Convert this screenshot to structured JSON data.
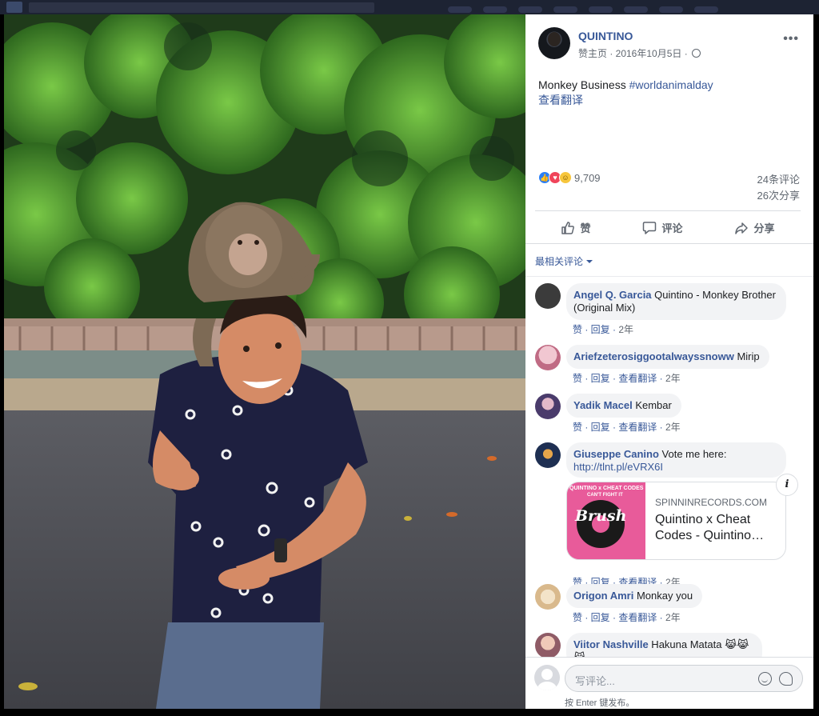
{
  "post": {
    "page_name": "QUINTINO",
    "meta": "赞主页 · 2016年10月5日 ·",
    "text": "Monkey Business ",
    "hashtag": "#worldanimalday",
    "translate": "查看翻译",
    "reaction_count": "9,709",
    "comments_count": "24条评论",
    "shares_count": "26次分享"
  },
  "actions": {
    "like": "赞",
    "comment": "评论",
    "share": "分享"
  },
  "sort_label": "最相关评论",
  "comments": [
    {
      "author": "Angel Q. Garcia",
      "text": " Quintino - Monkey Brother (Original Mix)",
      "actions": "赞 · 回复 · ",
      "age": "2年",
      "avatar_color": "#3b3b3b"
    },
    {
      "author": "Ariefzeterosiggootalwayssnoww",
      "text": " Mirip",
      "actions": "赞 · 回复 · 查看翻译 · ",
      "age": "2年",
      "avatar_color": "#d9a3b0"
    },
    {
      "author": "Yadik Macel",
      "text": " Kembar",
      "actions": "赞 · 回复 · 查看翻译 · ",
      "age": "2年",
      "avatar_color": "#4a3b6b"
    },
    {
      "author": "Giuseppe Canino",
      "text": " Vote me here:",
      "link": "http://tlnt.pl/eVRX6I",
      "actions": "赞 · 回复 · 查看翻译 · ",
      "age": "2年",
      "avatar_color": "#1e2f52"
    },
    {
      "author": "Origon Amri",
      "text": " Monkay you",
      "actions": "赞 · 回复 · 查看翻译 · ",
      "age": "2年",
      "avatar_color": "#e3cfa8"
    },
    {
      "author": "Viitor Nashville",
      "text": " Hakuna Matata 😹😹😹",
      "avatar_color": "#b08890"
    }
  ],
  "link_card": {
    "domain": "SPINNINRECORDS.COM",
    "title": "Quintino x Cheat Codes - Quintino…",
    "image_title": "Brush",
    "image_subtitle": "QUINTINO x CHEAT CODES",
    "image_sub2": "CAN'T FIGHT IT"
  },
  "composer": {
    "placeholder": "写评论...",
    "hint": "按 Enter 键发布。"
  },
  "colors": {
    "link_blue": "#385898",
    "like_blue": "#2a7ff6",
    "love_red": "#f0445a",
    "haha_yellow": "#f7c63c"
  },
  "icons": [
    "more-icon",
    "globe-icon",
    "like-reaction-icon",
    "love-reaction-icon",
    "haha-reaction-icon",
    "thumbs-up-icon",
    "comment-bubble-icon",
    "share-arrow-icon",
    "info-icon",
    "emoji-icon",
    "sticker-icon"
  ]
}
